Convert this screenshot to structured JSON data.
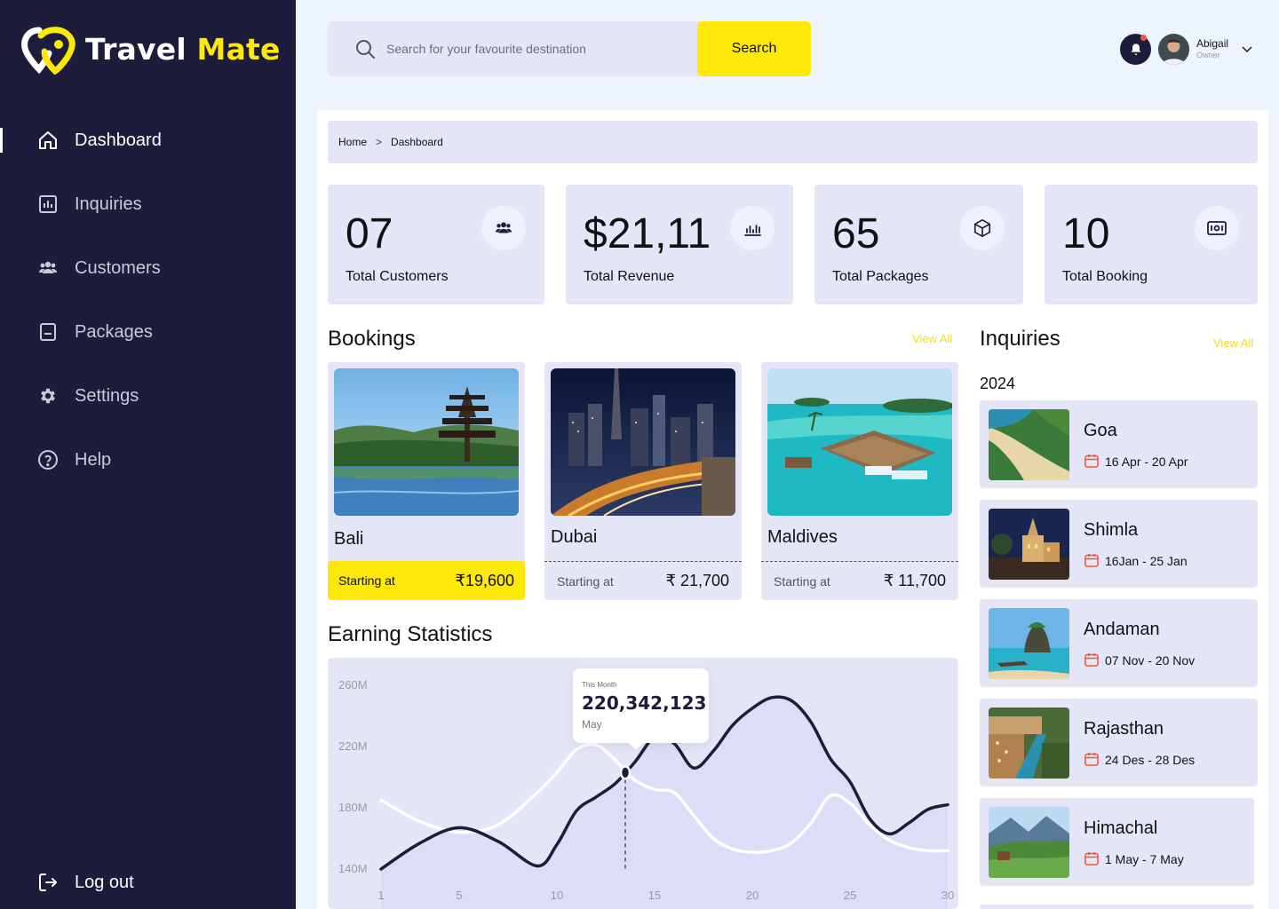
{
  "brand": {
    "name_part1": "Travel",
    "name_part2": "Mate",
    "accent_color": "#fde80a",
    "sidebar_color": "#1d1d3b"
  },
  "sidebar": {
    "items": [
      {
        "label": "Dashboard",
        "icon": "home-icon",
        "active": true
      },
      {
        "label": "Inquiries",
        "icon": "bar-chart-icon"
      },
      {
        "label": "Customers",
        "icon": "users-icon"
      },
      {
        "label": "Packages",
        "icon": "package-icon"
      },
      {
        "label": "Settings",
        "icon": "gear-icon"
      },
      {
        "label": "Help",
        "icon": "help-circle-icon"
      }
    ],
    "logout_label": "Log out"
  },
  "search": {
    "placeholder": "Search for your favourite destination",
    "button_label": "Search"
  },
  "user": {
    "name": "Abigail",
    "role": "Owner"
  },
  "breadcrumb": {
    "home": "Home",
    "separator": ">",
    "current": "Dashboard"
  },
  "stats": [
    {
      "value": "07",
      "label": "Total Customers",
      "icon": "users-icon"
    },
    {
      "value": "$21,11",
      "label": "Total Revenue",
      "icon": "revenue-chart-icon"
    },
    {
      "value": "65",
      "label": "Total Packages",
      "icon": "box-icon"
    },
    {
      "value": "10",
      "label": "Total Booking",
      "icon": "ticket-icon"
    }
  ],
  "bookings": {
    "title": "Bookings",
    "view_all": "View All",
    "cards": [
      {
        "name": "Bali",
        "starting_label": "Starting at",
        "price": "₹19,600",
        "highlighted": true
      },
      {
        "name": "Dubai",
        "starting_label": "Starting at",
        "price": "₹ 21,700"
      },
      {
        "name": "Maldives",
        "starting_label": "Starting at",
        "price": "₹ 11,700"
      }
    ]
  },
  "earnings": {
    "title": "Earning Statistics",
    "tooltip": {
      "label": "This Month",
      "value": "220,342,123",
      "month": "May"
    }
  },
  "chart_data": {
    "type": "line",
    "x": [
      1,
      3,
      5,
      7,
      9,
      10,
      11,
      12,
      13,
      14,
      15,
      16,
      17,
      18,
      19,
      20,
      21,
      22,
      23,
      24,
      25,
      26,
      27,
      28,
      29,
      30
    ],
    "xticks": [
      "1",
      "5",
      "10",
      "15",
      "20",
      "25",
      "30"
    ],
    "yticks": [
      "260M",
      "220M",
      "180M",
      "140M"
    ],
    "ylim": [
      140,
      260
    ],
    "series": [
      {
        "color": "#1d1d3b",
        "values": [
          140,
          157,
          167,
          158,
          142,
          156,
          178,
          187,
          196,
          210,
          226,
          222,
          206,
          217,
          234,
          245,
          252,
          250,
          236,
          212,
          197,
          173,
          163,
          170,
          179,
          182
        ]
      },
      {
        "color": "#ffffff",
        "values": [
          185,
          171,
          164,
          169,
          190,
          203,
          218,
          221,
          211,
          198,
          192,
          190,
          175,
          160,
          153,
          151,
          152,
          157,
          170,
          188,
          183,
          169,
          159,
          154,
          152,
          152
        ]
      }
    ],
    "highlight_x": 13.5
  },
  "inquiries": {
    "title": "Inquiries",
    "view_all": "View All",
    "year": "2024",
    "items": [
      {
        "name": "Goa",
        "dates": "16 Apr - 20 Apr"
      },
      {
        "name": "Shimla",
        "dates": "16Jan - 25 Jan"
      },
      {
        "name": "Andaman",
        "dates": "07 Nov - 20 Nov"
      },
      {
        "name": "Rajasthan",
        "dates": "24 Des - 28 Des"
      },
      {
        "name": "Himachal",
        "dates": "1 May - 7 May"
      }
    ]
  }
}
